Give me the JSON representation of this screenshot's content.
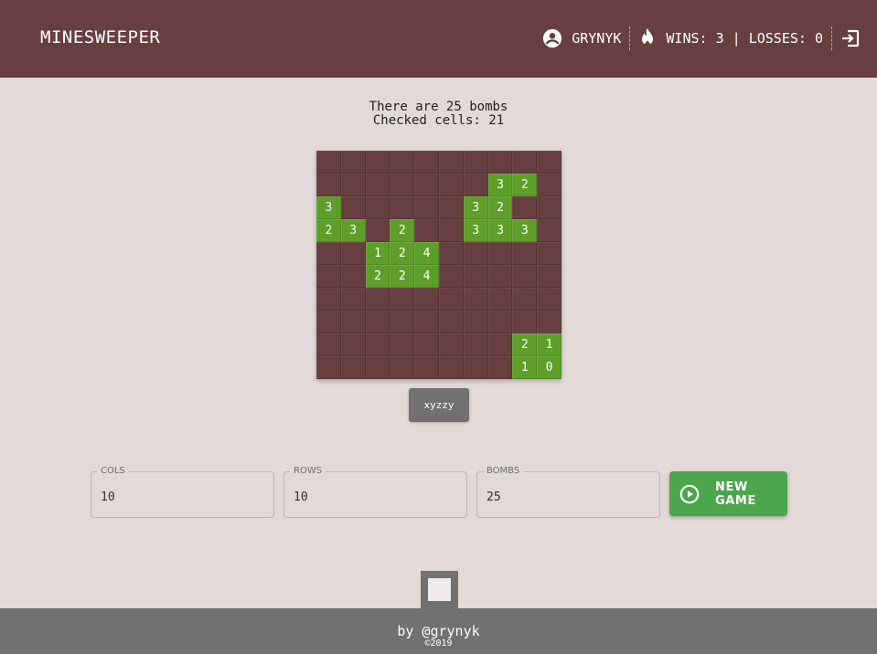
{
  "header": {
    "title": "MINESWEEPER",
    "username": "GRYNYK",
    "stats": "WINS: 3 | LOSSES: 0",
    "user_icon": "account-circle-icon",
    "fire_icon": "fire-icon",
    "logout_icon": "logout-icon"
  },
  "status": {
    "bombs_text": "There are 25 bombs",
    "checked_text": "Checked cells: 21"
  },
  "board": {
    "rows": [
      [
        "",
        "",
        "",
        "",
        "",
        "",
        "",
        "",
        "",
        ""
      ],
      [
        "",
        "",
        "",
        "",
        "",
        "",
        "",
        "3",
        "2",
        ""
      ],
      [
        "3",
        "",
        "",
        "",
        "",
        "",
        "3",
        "2",
        "",
        ""
      ],
      [
        "2",
        "3",
        "",
        "2",
        "",
        "",
        "3",
        "3",
        "3",
        ""
      ],
      [
        "",
        "",
        "1",
        "2",
        "4",
        "",
        "",
        "",
        "",
        ""
      ],
      [
        "",
        "",
        "2",
        "2",
        "4",
        "",
        "",
        "",
        "",
        ""
      ],
      [
        "",
        "",
        "",
        "",
        "",
        "",
        "",
        "",
        "",
        ""
      ],
      [
        "",
        "",
        "",
        "",
        "",
        "",
        "",
        "",
        "",
        ""
      ],
      [
        "",
        "",
        "",
        "",
        "",
        "",
        "",
        "",
        "2",
        "1"
      ],
      [
        "",
        "",
        "",
        "",
        "",
        "",
        "",
        "",
        "1",
        "0"
      ]
    ]
  },
  "cheat_button": "xyzzy",
  "settings": {
    "cols_label": "COLS",
    "cols_value": "10",
    "rows_label": "ROWS",
    "rows_value": "10",
    "bombs_label": "BOMBS",
    "bombs_value": "25"
  },
  "new_game": {
    "label": "NEW GAME",
    "icon": "play-circle-icon"
  },
  "footer": {
    "by": "by @grynyk",
    "copyright": "©2019"
  },
  "colors": {
    "brand": "#673f40",
    "open_cell": "#5e9f2a",
    "new_game": "#4ca64c",
    "background": "#e2d9d8",
    "footer": "#727170"
  }
}
